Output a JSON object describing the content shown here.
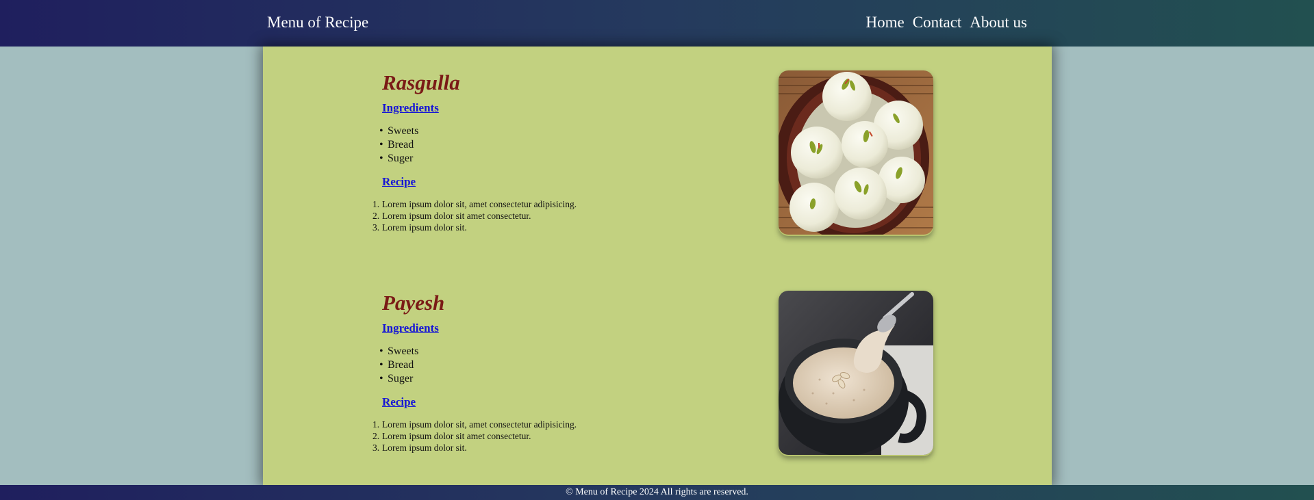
{
  "header": {
    "brand": "Menu of Recipe",
    "nav": [
      {
        "label": "Home"
      },
      {
        "label": "Contact"
      },
      {
        "label": "About us"
      }
    ]
  },
  "recipes": [
    {
      "title": "Rasgulla",
      "ingredients_heading": "Ingredients",
      "ingredients": [
        "Sweets",
        "Bread",
        "Suger"
      ],
      "recipe_heading": "Recipe",
      "steps": [
        "Lorem ipsum dolor sit, amet consectetur adipisicing.",
        "Lorem ipsum dolor sit amet consectetur.",
        "Lorem ipsum dolor sit."
      ],
      "image": "rasgulla-photo"
    },
    {
      "title": "Payesh",
      "ingredients_heading": "Ingredients",
      "ingredients": [
        "Sweets",
        "Bread",
        "Suger"
      ],
      "recipe_heading": "Recipe",
      "steps": [
        "Lorem ipsum dolor sit, amet consectetur adipisicing.",
        "Lorem ipsum dolor sit amet consectetur.",
        "Lorem ipsum dolor sit."
      ],
      "image": "payesh-photo"
    }
  ],
  "footer": {
    "text": "© Menu of Recipe 2024 All rights are reserved."
  },
  "colors": {
    "background": "#a3bebf",
    "card": "#c2d180",
    "title": "#7a1a16",
    "link_heading": "#1515d6",
    "header_gradient": [
      "#1f1f5e",
      "#225050"
    ]
  }
}
